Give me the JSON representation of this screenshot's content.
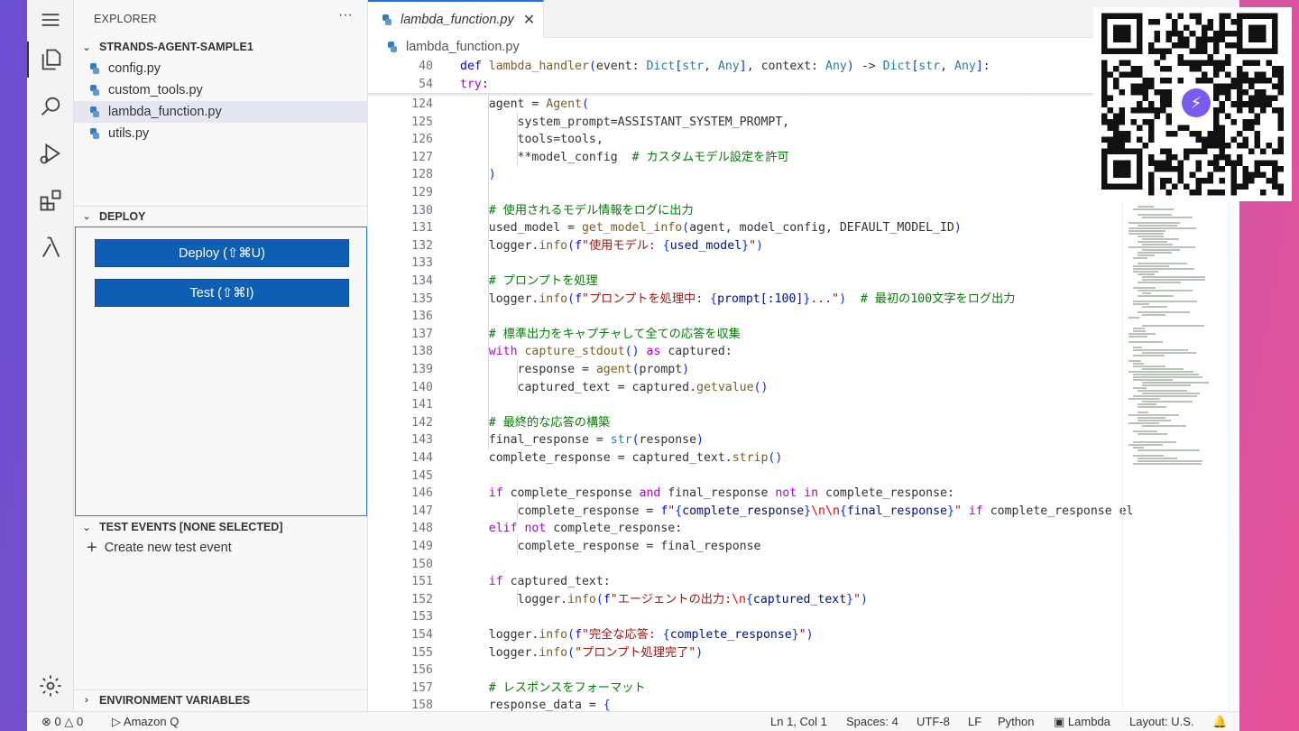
{
  "sidebar": {
    "title": "EXPLORER",
    "more": "···",
    "project": "STRANDS-AGENT-SAMPLE1",
    "files": [
      "config.py",
      "custom_tools.py",
      "lambda_function.py",
      "utils.py"
    ],
    "selected_file": "lambda_function.py",
    "deploy_section": "DEPLOY",
    "deploy_button": "Deploy (⇧⌘U)",
    "test_button": "Test (⇧⌘I)",
    "test_events_section": "TEST EVENTS [NONE SELECTED]",
    "create_event": "Create new test event",
    "env_section": "ENVIRONMENT VARIABLES"
  },
  "editor": {
    "tab": "lambda_function.py",
    "breadcrumb": "lambda_function.py",
    "sticky": [
      {
        "num": "40",
        "code": "def lambda_handler(event: Dict[str, Any], context: Any) -> Dict[str, Any]:"
      },
      {
        "num": "54",
        "code": "    try:"
      }
    ],
    "lines": [
      {
        "num": "124",
        "code": "        agent = Agent("
      },
      {
        "num": "125",
        "code": "            system_prompt=ASSISTANT_SYSTEM_PROMPT,"
      },
      {
        "num": "126",
        "code": "            tools=tools,"
      },
      {
        "num": "127",
        "code": "            **model_config  # カスタムモデル設定を許可"
      },
      {
        "num": "128",
        "code": "        )"
      },
      {
        "num": "129",
        "code": ""
      },
      {
        "num": "130",
        "code": "        # 使用されるモデル情報をログに出力"
      },
      {
        "num": "131",
        "code": "        used_model = get_model_info(agent, model_config, DEFAULT_MODEL_ID)"
      },
      {
        "num": "132",
        "code": "        logger.info(f\"使用モデル: {used_model}\")"
      },
      {
        "num": "133",
        "code": ""
      },
      {
        "num": "134",
        "code": "        # プロンプトを処理"
      },
      {
        "num": "135",
        "code": "        logger.info(f\"プロンプトを処理中: {prompt[:100]}...\")  # 最初の100文字をログ出力"
      },
      {
        "num": "136",
        "code": ""
      },
      {
        "num": "137",
        "code": "        # 標準出力をキャプチャして全ての応答を収集"
      },
      {
        "num": "138",
        "code": "        with capture_stdout() as captured:"
      },
      {
        "num": "139",
        "code": "            response = agent(prompt)"
      },
      {
        "num": "140",
        "code": "            captured_text = captured.getvalue()"
      },
      {
        "num": "141",
        "code": ""
      },
      {
        "num": "142",
        "code": "        # 最終的な応答の構築"
      },
      {
        "num": "143",
        "code": "        final_response = str(response)"
      },
      {
        "num": "144",
        "code": "        complete_response = captured_text.strip()"
      },
      {
        "num": "145",
        "code": ""
      },
      {
        "num": "146",
        "code": "        if complete_response and final_response not in complete_response:"
      },
      {
        "num": "147",
        "code": "            complete_response = f\"{complete_response}\\n\\n{final_response}\" if complete_response el"
      },
      {
        "num": "148",
        "code": "        elif not complete_response:"
      },
      {
        "num": "149",
        "code": "            complete_response = final_response"
      },
      {
        "num": "150",
        "code": ""
      },
      {
        "num": "151",
        "code": "        if captured_text:"
      },
      {
        "num": "152",
        "code": "            logger.info(f\"エージェントの出力:\\n{captured_text}\")"
      },
      {
        "num": "153",
        "code": ""
      },
      {
        "num": "154",
        "code": "        logger.info(f\"完全な応答: {complete_response}\")"
      },
      {
        "num": "155",
        "code": "        logger.info(\"プロンプト処理完了\")"
      },
      {
        "num": "156",
        "code": ""
      },
      {
        "num": "157",
        "code": "        # レスポンスをフォーマット"
      },
      {
        "num": "158",
        "code": "        response_data = {"
      }
    ]
  },
  "statusbar": {
    "errors": "0",
    "warnings": "0",
    "amazonq": "Amazon Q",
    "position": "Ln 1, Col 1",
    "spaces": "Spaces: 4",
    "encoding": "UTF-8",
    "eol": "LF",
    "language": "Python",
    "lambda": "Lambda",
    "layout": "Layout: U.S."
  },
  "icons": [
    "menu-icon",
    "files-icon",
    "search-icon",
    "run-debug-icon",
    "extensions-icon",
    "lambda-icon",
    "gear-icon",
    "python-file-icon",
    "bell-icon",
    "qr-code",
    "lightning-icon"
  ],
  "colors": {
    "accent": "#0c5fb4",
    "keyword": "#af00db",
    "function": "#795e26",
    "comment": "#008000",
    "string": "#a31515"
  }
}
